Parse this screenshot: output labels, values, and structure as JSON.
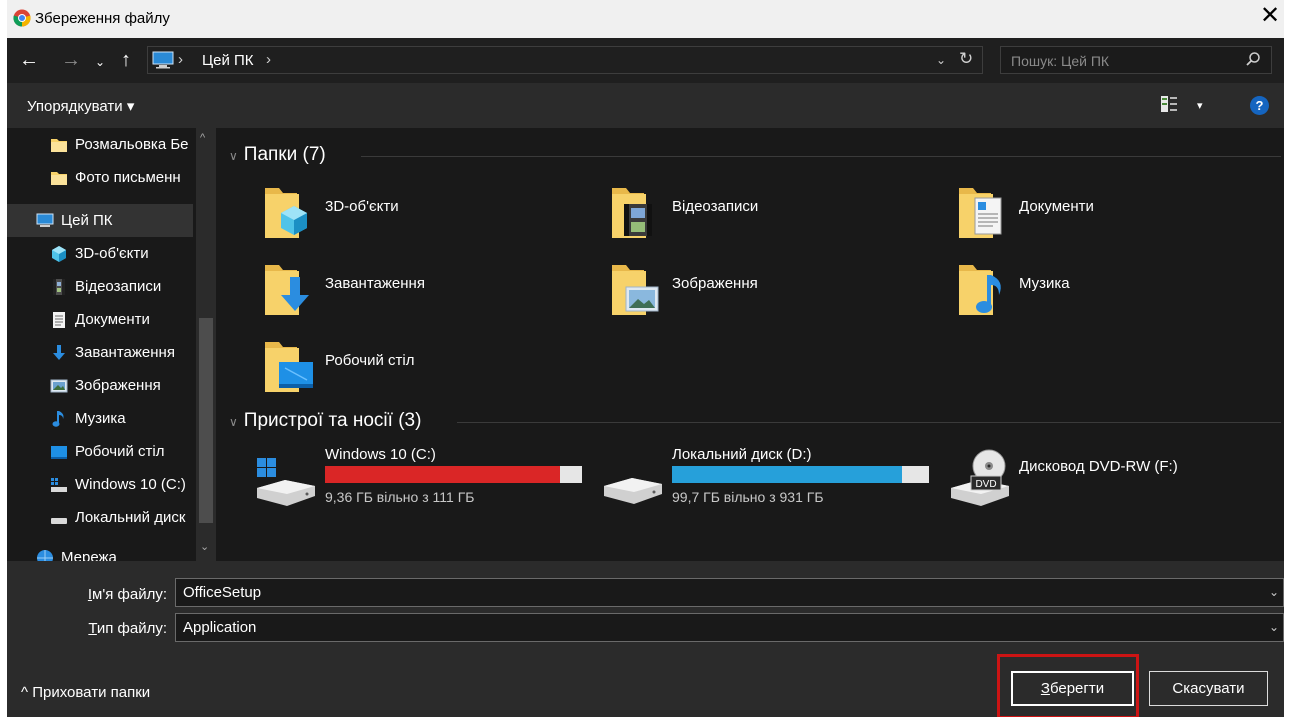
{
  "window": {
    "title": "Збереження файлу",
    "close_glyph": "✕"
  },
  "nav": {
    "back": "←",
    "forward": "→",
    "recent": "⌄",
    "up": "↑",
    "breadcrumb": [
      "Цей ПК"
    ],
    "separator": "›",
    "dropdown": "⌄",
    "refresh": "↻",
    "search_placeholder": "Пошук: Цей ПК"
  },
  "toolbar": {
    "organize_label": "Упорядкувати ▾",
    "view_dropdown": "▾",
    "help": "?"
  },
  "sidebar": {
    "items": [
      {
        "label": "Розмальовка Бе",
        "icon": "folder-icon"
      },
      {
        "label": "Фото письменн",
        "icon": "folder-icon"
      },
      {
        "label": "Цей ПК",
        "icon": "computer-icon",
        "selected": true
      },
      {
        "label": "3D-об'єкти",
        "icon": "3d-objects-icon"
      },
      {
        "label": "Відеозаписи",
        "icon": "videos-icon"
      },
      {
        "label": "Документи",
        "icon": "documents-icon"
      },
      {
        "label": "Завантаження",
        "icon": "downloads-icon"
      },
      {
        "label": "Зображення",
        "icon": "pictures-icon"
      },
      {
        "label": "Музика",
        "icon": "music-icon"
      },
      {
        "label": "Робочий стіл",
        "icon": "desktop-icon"
      },
      {
        "label": "Windows 10 (C:)",
        "icon": "drive-icon"
      },
      {
        "label": "Локальний диск",
        "icon": "drive-icon"
      },
      {
        "label": "Мережа",
        "icon": "network-icon"
      }
    ],
    "scroll_up": "^",
    "scroll_down": "⌄"
  },
  "content": {
    "folders_header": "Папки (7)",
    "folders": [
      {
        "name": "3D-об'єкти",
        "icon": "3d-objects-folder-icon"
      },
      {
        "name": "Відеозаписи",
        "icon": "videos-folder-icon"
      },
      {
        "name": "Документи",
        "icon": "documents-folder-icon"
      },
      {
        "name": "Завантаження",
        "icon": "downloads-folder-icon"
      },
      {
        "name": "Зображення",
        "icon": "pictures-folder-icon"
      },
      {
        "name": "Музика",
        "icon": "music-folder-icon"
      },
      {
        "name": "Робочий стіл",
        "icon": "desktop-folder-icon"
      }
    ],
    "devices_header": "Пристрої та носії (3)",
    "devices": [
      {
        "name": "Windows 10 (C:)",
        "free_text": "9,36 ГБ вільно з 111 ГБ",
        "used_fraction": 0.916,
        "bar_color": "#da2626"
      },
      {
        "name": "Локальний диск (D:)",
        "free_text": "99,7 ГБ вільно з 931 ГБ",
        "used_fraction": 0.893,
        "bar_color": "#26a0da"
      },
      {
        "name": "Дисковод DVD-RW (F:)",
        "icon_label": "DVD"
      }
    ]
  },
  "form": {
    "filename_label_accel": "І",
    "filename_label_rest": "м'я файлу:",
    "filename_value": "OfficeSetup",
    "filetype_label_accel": "Т",
    "filetype_label_rest": "ип файлу:",
    "filetype_value": "Application",
    "chevron": "⌄"
  },
  "footer": {
    "hide_folders_label": "^  Приховати папки",
    "save_accel": "З",
    "save_rest": "берегти",
    "cancel_label": "Скасувати"
  },
  "colors": {
    "highlight": "#cc1414",
    "accent": "#1565c0"
  }
}
